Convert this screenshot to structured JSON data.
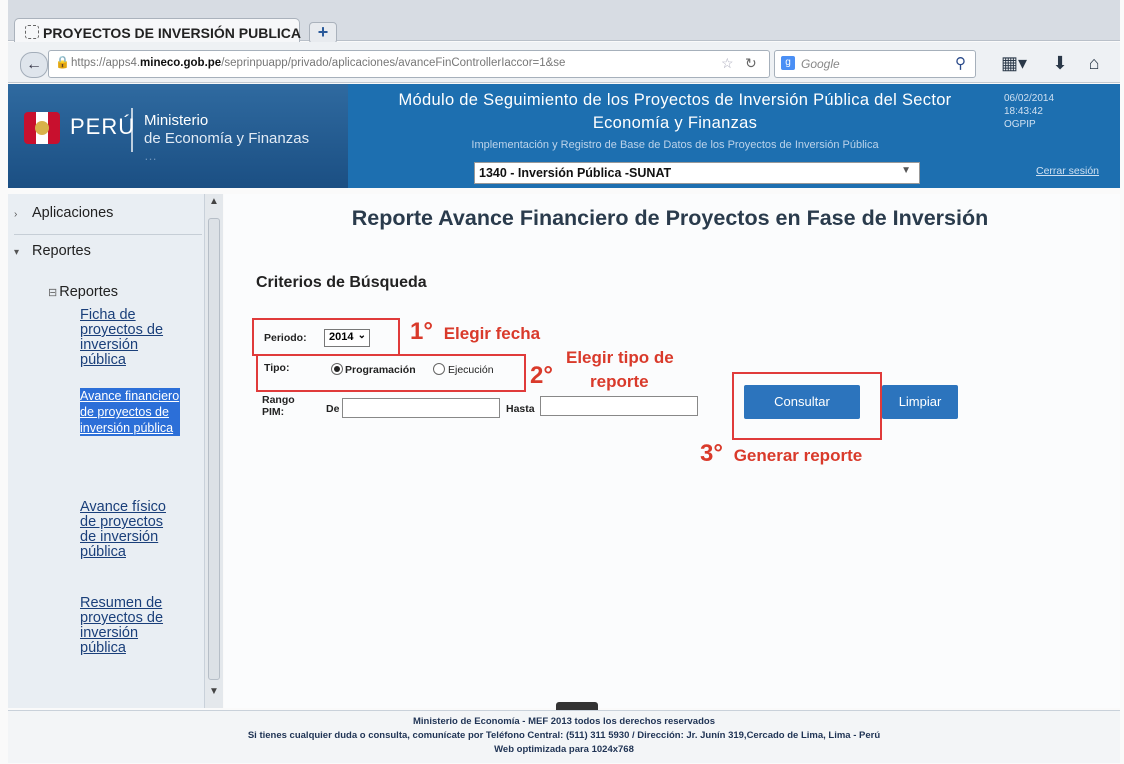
{
  "browser": {
    "tab_title": "PROYECTOS DE INVERSIÓN PUBLICA",
    "new_tab": "+",
    "url_prefix": "https://apps4.",
    "url_domain": "mineco.gob.pe",
    "url_path": "/seprinpuapp/privado/aplicaciones/avanceFinControllerIaccor=1&se",
    "search_placeholder": "Google"
  },
  "header": {
    "brand": "PERÚ",
    "ministry_line1": "Ministerio",
    "ministry_line2": "de Economía y Finanzas",
    "ministry_line3": "…",
    "title_line1": "Módulo de Seguimiento de los Proyectos de Inversión Pública del Sector",
    "title_line2": "Economía y Finanzas",
    "subtitle": "Implementación y Registro de Base de Datos de los Proyectos de Inversión Pública",
    "date": "06/02/2014",
    "time": "18:43:42",
    "office": "OGPIP",
    "logout": "Cerrar sesión",
    "unit_select": "1340 - Inversión Pública -SUNAT"
  },
  "sidebar": {
    "section1": "Aplicaciones",
    "section2": "Reportes",
    "tree_root": "Reportes",
    "links": [
      "Ficha de proyectos de inversión pública",
      "Avance financiero de proyectos de inversión pública",
      "Avance físico de proyectos de inversión pública",
      "Resumen de proyectos de inversión pública"
    ]
  },
  "main": {
    "title": "Reporte Avance Financiero de Proyectos en Fase de Inversión",
    "criteria_title": "Criterios de Búsqueda",
    "periodo_label": "Periodo:",
    "periodo_value": "2014",
    "tipo_label": "Tipo:",
    "radio_programacion": "Programación",
    "radio_ejecucion": "Ejecución",
    "rango_label_1": "Rango",
    "rango_label_2": "PIM:",
    "de_label": "De",
    "hasta_label": "Hasta",
    "btn_consultar": "Consultar",
    "btn_limpiar": "Limpiar"
  },
  "annotations": {
    "step1_num": "1°",
    "step1_text": "Elegir fecha",
    "step2_num": "2°",
    "step2_text_a": "Elegir tipo de",
    "step2_text_b": "reporte",
    "step3_num": "3°",
    "step3_text": "Generar reporte"
  },
  "footer": {
    "line1": "Ministerio de Economía - MEF 2013 todos los derechos reservados",
    "line2": "Si tienes cualquier duda o consulta, comunícate por Teléfono Central: (511) 311 5930 / Dirección: Jr. Junín 319,Cercado de Lima, Lima - Perú",
    "line3": "Web optimizada para 1024x768"
  },
  "colors": {
    "header_blue": "#1d6fb0",
    "button_blue": "#2c74bd",
    "annotation_red": "#d93a2b",
    "selected_link": "#2c6fd8"
  }
}
